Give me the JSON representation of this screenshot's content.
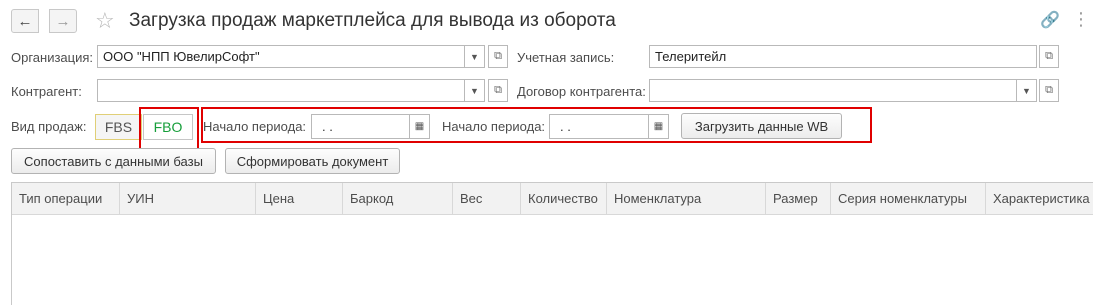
{
  "header": {
    "title": "Загрузка продаж маркетплейса для вывода из оборота",
    "back_icon": "←",
    "forward_icon": "→",
    "star_icon": "☆",
    "link_icon": "🔗",
    "menu_icon": "⋮"
  },
  "form": {
    "organization_label": "Организация:",
    "organization_value": "ООО \"НПП ЮвелирСофт\"",
    "account_label": "Учетная запись:",
    "account_value": "Телеритейл",
    "counterparty_label": "Контрагент:",
    "counterparty_value": "",
    "contract_label": "Договор контрагента:",
    "contract_value": "",
    "sale_type_label": "Вид продаж:",
    "sale_type_options": [
      "FBS",
      "FBO"
    ],
    "period_start_label": "Начало периода:",
    "period_start_value": " .  .",
    "period_start2_label": "Начало периода:",
    "period_start2_value": " .  .",
    "load_button": "Загрузить данные WB"
  },
  "actions": {
    "compare_button": "Сопоставить с данными базы",
    "create_button": "Сформировать документ"
  },
  "table": {
    "columns": [
      "Тип операции",
      "УИН",
      "Цена",
      "Баркод",
      "Вес",
      "Количество",
      "Номенклатура",
      "Размер",
      "Серия номенклатуры",
      "Характеристика"
    ]
  },
  "colors": {
    "highlight": "#e00000",
    "selected_toggle_text": "#169e3a"
  }
}
